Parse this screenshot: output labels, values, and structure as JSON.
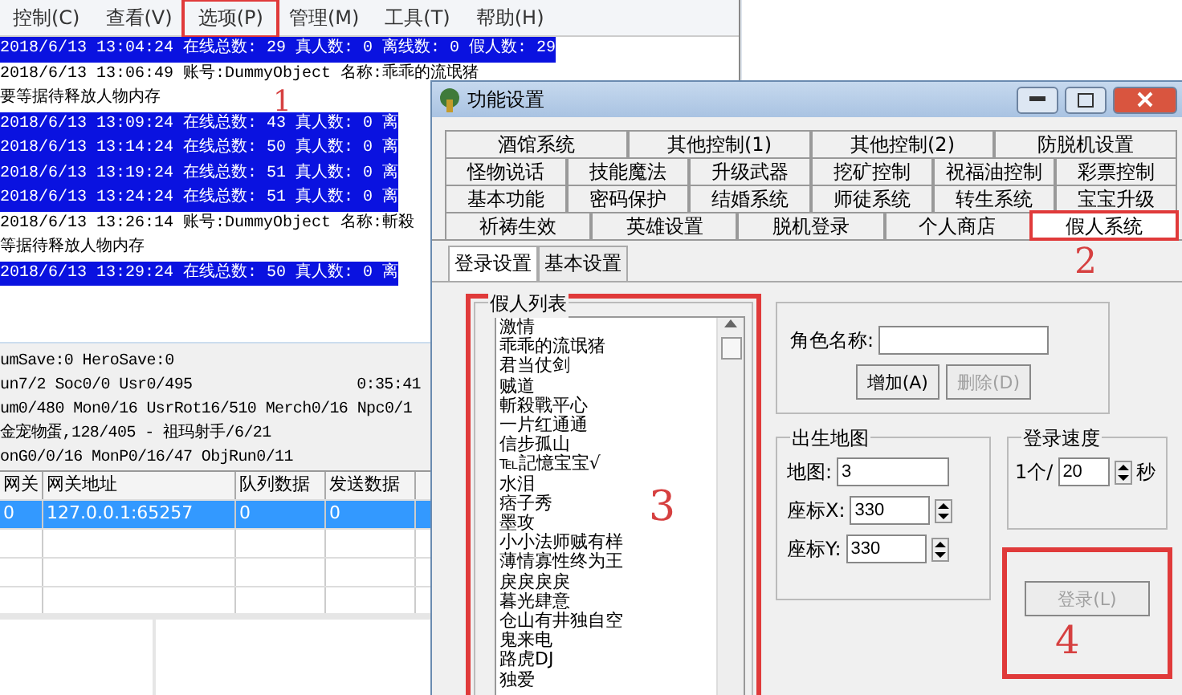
{
  "main_window": {
    "menu": [
      {
        "label": "控制(C)",
        "highlighted": false
      },
      {
        "label": "查看(V)",
        "highlighted": false
      },
      {
        "label": "选项(P)",
        "highlighted": true,
        "callout": "1"
      },
      {
        "label": "管理(M)",
        "highlighted": false
      },
      {
        "label": "工具(T)",
        "highlighted": false
      },
      {
        "label": "帮助(H)",
        "highlighted": false
      }
    ],
    "log": [
      {
        "text": "2018/6/13 13:04:24 在线总数: 29 真人数: 0 离线数: 0 假人数: 29",
        "selected": true
      },
      {
        "text": "2018/6/13 13:06:49 账号:DummyObject 名称:乖乖的流氓猪",
        "selected": false
      },
      {
        "text": "要等据待释放人物内存",
        "selected": false
      },
      {
        "text": "2018/6/13 13:09:24 在线总数: 43 真人数: 0 离",
        "selected": true
      },
      {
        "text": "2018/6/13 13:14:24 在线总数: 50 真人数: 0 离",
        "selected": true
      },
      {
        "text": "2018/6/13 13:19:24 在线总数: 51 真人数: 0 离",
        "selected": true
      },
      {
        "text": "2018/6/13 13:24:24 在线总数: 51 真人数: 0 离",
        "selected": true
      },
      {
        "text": "2018/6/13 13:26:14 账号:DummyObject 名称:斬殺",
        "selected": false
      },
      {
        "text": "等据待释放人物内存",
        "selected": false
      },
      {
        "text": "2018/6/13 13:29:24 在线总数: 50 真人数: 0 离",
        "selected": true
      }
    ],
    "status_lines": [
      {
        "text": "umSave:0 HeroSave:0"
      },
      {
        "text": "un7/2 Soc0/0 Usr0/495",
        "time": "0:35:41"
      },
      {
        "text": "um0/480 Mon0/16 UsrRot16/510 Merch0/16 Npc0/1"
      },
      {
        "text": "金宠物蛋,128/405 - 祖玛射手/6/21"
      },
      {
        "text": "onG0/0/16 MonP0/16/47 ObjRun0/11"
      }
    ],
    "table": {
      "columns": [
        "网关",
        "网关地址",
        "队列数据",
        "发送数据"
      ],
      "rows": [
        {
          "cells": [
            "0",
            "127.0.0.1:65257",
            "0",
            "0"
          ],
          "selected": true
        }
      ]
    }
  },
  "dialog": {
    "title": "功能设置",
    "tab_rows": [
      [
        {
          "label": "酒馆系统",
          "selected": false
        },
        {
          "label": "其他控制(1)",
          "selected": false
        },
        {
          "label": "其他控制(2)",
          "selected": false
        },
        {
          "label": "防脱机设置",
          "selected": false
        }
      ],
      [
        {
          "label": "怪物说话",
          "selected": false
        },
        {
          "label": "技能魔法",
          "selected": false
        },
        {
          "label": "升级武器",
          "selected": false
        },
        {
          "label": "挖矿控制",
          "selected": false
        },
        {
          "label": "祝福油控制",
          "selected": false
        },
        {
          "label": "彩票控制",
          "selected": false
        }
      ],
      [
        {
          "label": "基本功能",
          "selected": false
        },
        {
          "label": "密码保护",
          "selected": false
        },
        {
          "label": "结婚系统",
          "selected": false
        },
        {
          "label": "师徒系统",
          "selected": false
        },
        {
          "label": "转生系统",
          "selected": false
        },
        {
          "label": "宝宝升级",
          "selected": false
        }
      ],
      [
        {
          "label": "祈祷生效",
          "selected": false
        },
        {
          "label": "英雄设置",
          "selected": false
        },
        {
          "label": "脱机登录",
          "selected": false
        },
        {
          "label": "个人商店",
          "selected": false
        },
        {
          "label": "假人系统",
          "selected": true,
          "highlighted": true,
          "callout": "2"
        }
      ]
    ],
    "sub_tabs": [
      {
        "label": "登录设置",
        "selected": true
      },
      {
        "label": "基本设置",
        "selected": false
      }
    ],
    "fake_list": {
      "title": "假人列表",
      "highlighted": true,
      "callout": "3",
      "items": [
        "激情",
        "乖乖的流氓猪",
        "君当仗剑",
        "贼道",
        "斬殺戰平心",
        "一片红通通",
        "信步孤山",
        "℡記憶宝宝√",
        "水泪",
        "痞子秀",
        "墨攻",
        "小小法师贼有样",
        "薄情寡性终为王",
        "戾戾戾戾",
        "暮光肆意",
        "仓山有井独自空",
        "鬼来电",
        "路虎DJ",
        "独爱"
      ]
    },
    "role_name": {
      "label": "角色名称:"
    },
    "buttons": [
      {
        "label": "增加(A)",
        "disabled": false
      },
      {
        "label": "删除(D)",
        "disabled": true
      }
    ],
    "birth_map": {
      "title": "出生地图",
      "fields": [
        {
          "label": "地图:",
          "value": "3",
          "kind": "text"
        },
        {
          "label": "座标X:",
          "value": "330",
          "kind": "spin"
        },
        {
          "label": "座标Y:",
          "value": "330",
          "kind": "spin"
        }
      ]
    },
    "login_speed": {
      "title": "登录速度",
      "prefix": "1个/",
      "value": "20",
      "suffix": "秒"
    },
    "login_button": {
      "label": "登录(L)",
      "disabled": true,
      "highlighted": true,
      "callout": "4"
    }
  }
}
